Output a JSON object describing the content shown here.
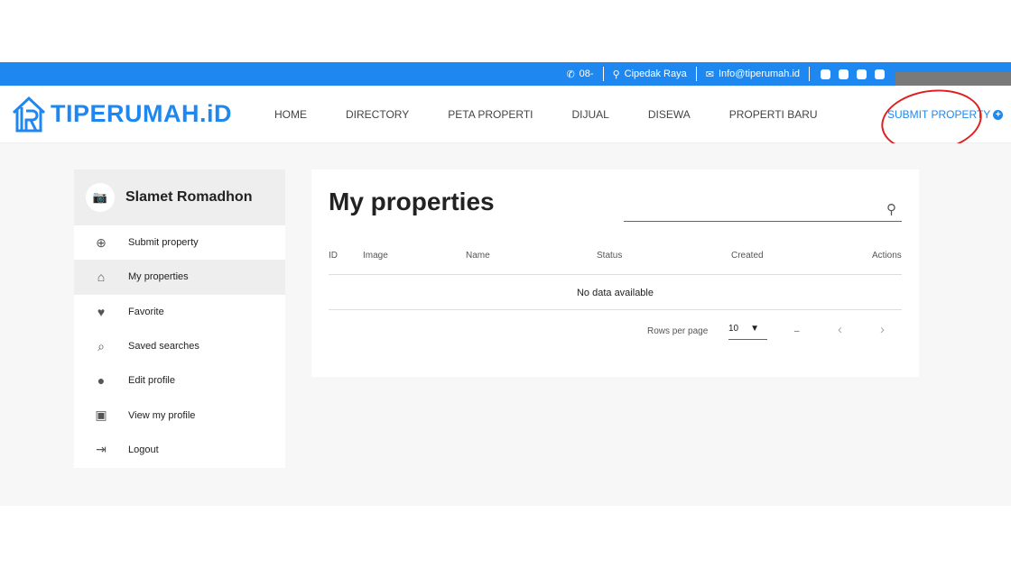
{
  "topbar": {
    "phone": "08-",
    "location": "Cipedak Raya",
    "email": "Info@tiperumah.id",
    "social": [
      "facebook-icon",
      "twitter-icon",
      "instagram-icon",
      "linkedin-icon"
    ]
  },
  "header": {
    "logo": "TIPERUMAH.iD",
    "nav": [
      "HOME",
      "DIRECTORY",
      "PETA PROPERTI",
      "DIJUAL",
      "DISEWA",
      "PROPERTI BARU"
    ],
    "submit": "SUBMIT PROPERTY"
  },
  "sidebar": {
    "user": "Slamet Romadhon",
    "items": [
      {
        "label": "Submit property",
        "icon": "⊕"
      },
      {
        "label": "My properties",
        "icon": "⌂"
      },
      {
        "label": "Favorite",
        "icon": "♥"
      },
      {
        "label": "Saved searches",
        "icon": "⌕"
      },
      {
        "label": "Edit profile",
        "icon": "●"
      },
      {
        "label": "View my profile",
        "icon": "▣"
      },
      {
        "label": "Logout",
        "icon": "⇥"
      }
    ],
    "active": 1
  },
  "main": {
    "title": "My properties",
    "columns": [
      "ID",
      "Image",
      "Name",
      "Status",
      "Created",
      "Actions"
    ],
    "empty": "No data available",
    "rows_per_page_label": "Rows per page",
    "rows_per_page": "10",
    "range": "–"
  },
  "colors": {
    "brand": "#1e88f0",
    "annotation": "#e02020"
  }
}
